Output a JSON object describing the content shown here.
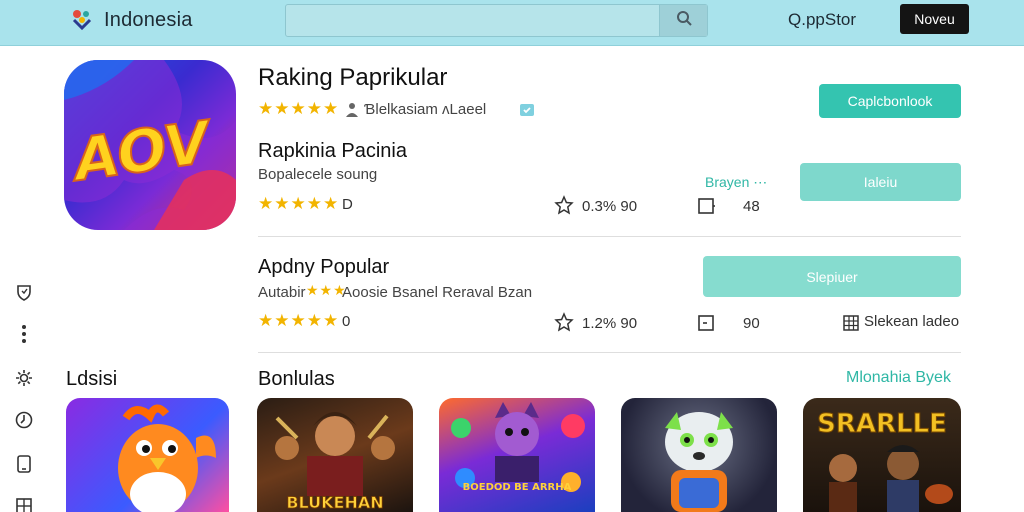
{
  "header": {
    "brand": "Indonesia",
    "search_placeholder": "",
    "store_link": "Q.ppStor",
    "action_button": "Noveu"
  },
  "rail": {
    "icons": [
      "shield-icon",
      "more-vertical-icon",
      "settings-icon",
      "history-icon",
      "tablet-icon",
      "grid-icon"
    ]
  },
  "featured": {
    "icon_text": "AOV",
    "title": "Raking Paprikular",
    "rating_stars": "★★★★★",
    "rating_meta": "Ɓlelkasiam ᴧLaeel",
    "primary_button": "Caplcbonlook"
  },
  "row1": {
    "title": "Rapkinia Pacinia",
    "subtitle": "Bopalecele soung",
    "stars": "★★★★★",
    "rating": "D",
    "stat1": "0.3% 90",
    "stat2": "48",
    "link": "Brayen ⋯",
    "button": "Ialeiu"
  },
  "row2": {
    "title": "Apdny Popular",
    "subtitle_prefix": "Autabir",
    "subtitle_stars": "★★★",
    "subtitle_text": "Aoosie Bsanel Reraval Bzan",
    "stars": "★★★★★",
    "rating": "0",
    "stat1": "1.2% 90",
    "stat2": "90",
    "extra": "Slekean ladeo",
    "button": "Slepiuer"
  },
  "sections": {
    "left_label": "Ldsisi",
    "main_label": "Bonlulas",
    "link": "Mlonahia Byek"
  },
  "thumbnails": {
    "t2_text": "BLUKEHAN",
    "t3_text": "BOEDOD BE ARRHA",
    "t5_text": "SRARLLE"
  },
  "colors": {
    "header_bg": "#a9e3ec",
    "accent": "#34c4b0",
    "star": "#f2b400"
  }
}
